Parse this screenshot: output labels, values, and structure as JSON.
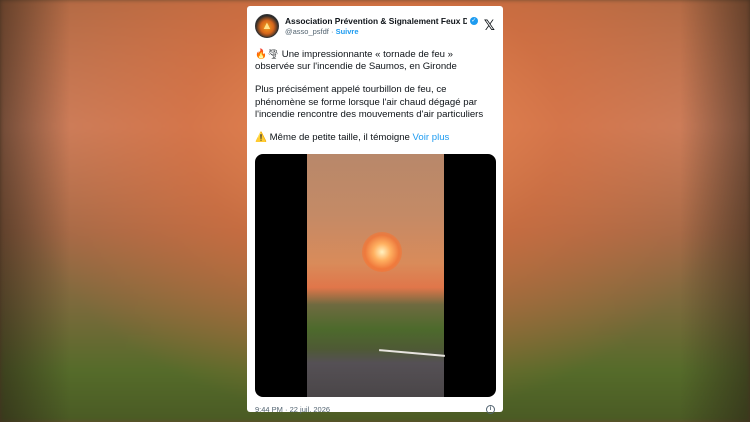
{
  "tweet": {
    "display_name": "Association Prévention & Signalement Feux De F...",
    "handle": "@asso_psfdf",
    "separator": "·",
    "follow_label": "Suivre",
    "emoji_line1": "🔥🌪",
    "text_line1": " Une impressionnante « tornade de feu » observée sur l'incendie de Saumos, en Gironde",
    "text_para2": "Plus précisément appelé tourbillon de feu, ce phénomène se forme lorsque l'air chaud dégagé par l'incendie rencontre des mouvements d'air particuliers",
    "warning_emoji": "⚠️",
    "text_para3": " Même de petite taille, il témoigne ",
    "see_more": "Voir plus",
    "timestamp": "9:44 PM · 22 juil. 2026"
  },
  "icons": {
    "verified": "verified-badge-icon",
    "x_logo": "x-logo-icon",
    "info": "info-icon"
  },
  "colors": {
    "accent": "#1d9bf0",
    "text": "#0f1419",
    "muted": "#536471"
  }
}
